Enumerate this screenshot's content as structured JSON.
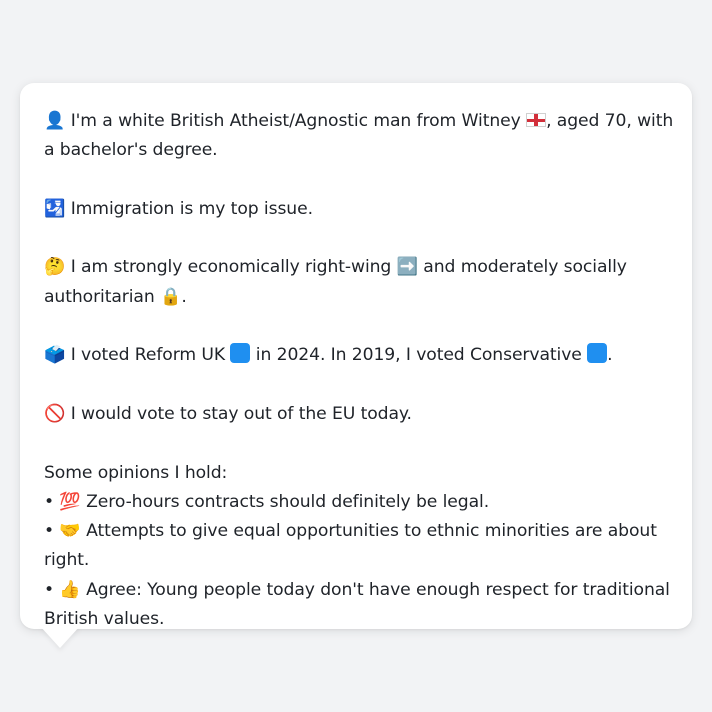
{
  "profile": {
    "intro_pre": "I'm a white British Atheist/Agnostic man from Witney",
    "intro_post": ", aged 70, with a bachelor's degree.",
    "issue": "Immigration is my top issue.",
    "stance_pre": "I am strongly economically right-wing",
    "stance_mid": "and moderately socially authoritarian",
    "stance_post": ".",
    "vote_pre": "I voted Reform UK",
    "vote_mid": "in 2024. In 2019, I voted Conservative",
    "vote_post": ".",
    "eu": "I would vote to stay out of the EU today.",
    "opinions_heading": "Some opinions I hold:",
    "opinions": [
      {
        "bullet": "•",
        "emoji": "💯",
        "text": "Zero-hours contracts should definitely be legal."
      },
      {
        "bullet": "•",
        "emoji": "🤝",
        "text": "Attempts to give equal opportunities to ethnic minorities are about right."
      },
      {
        "bullet": "•",
        "emoji": "👍",
        "text": "Agree: Young people today don't have enough respect for traditional British values."
      }
    ]
  },
  "icons": {
    "person": "👤",
    "passport": "🛂",
    "thinking": "🤔",
    "arrow": "➡️",
    "lock": "🔒",
    "ballot": "🗳️",
    "no_entry": "🚫",
    "flag": "england-flag-icon",
    "party_box": "blue-square-icon"
  },
  "colors": {
    "party_blue": "#1f8ff0",
    "background": "#f2f3f5",
    "card": "#ffffff",
    "text": "#1f2329"
  }
}
